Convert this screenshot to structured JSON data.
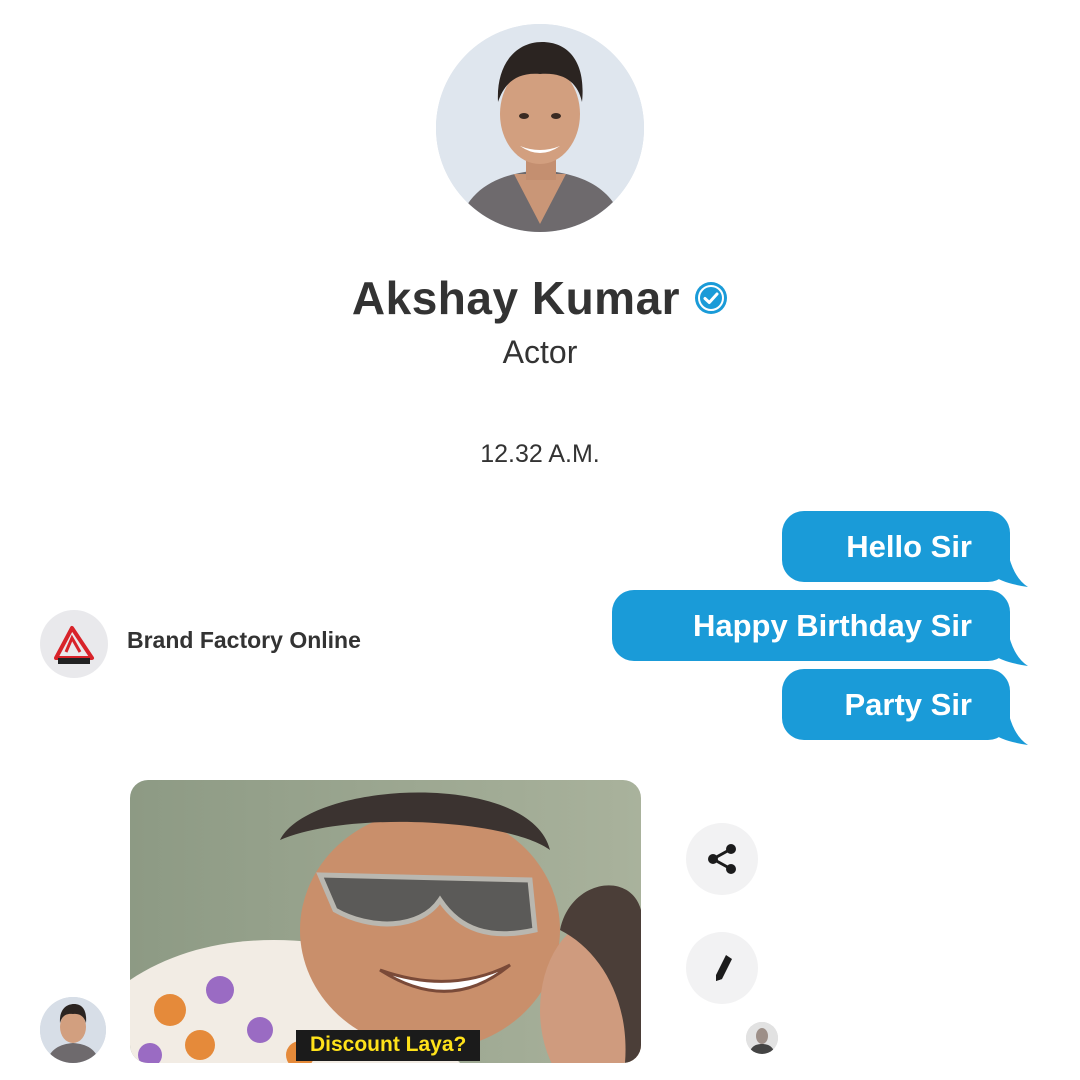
{
  "profile": {
    "name": "Akshay Kumar",
    "role": "Actor",
    "avatar_icon": "profile-photo",
    "verified_icon": "verified-badge-icon",
    "verified_color": "#1a9bd8"
  },
  "conversation": {
    "timestamp": "12.32 A.M.",
    "outgoing": [
      {
        "text": "Hello Sir"
      },
      {
        "text": "Happy Birthday Sir"
      },
      {
        "text": "Party Sir"
      }
    ],
    "bubble_color": "#1a9bd8",
    "sender": {
      "name": "Brand Factory Online",
      "logo_icon": "brand-factory-logo"
    },
    "reply_gif": {
      "caption": "Discount Laya?"
    }
  },
  "actions": {
    "share_icon": "share-icon",
    "edit_icon": "pencil-icon"
  }
}
